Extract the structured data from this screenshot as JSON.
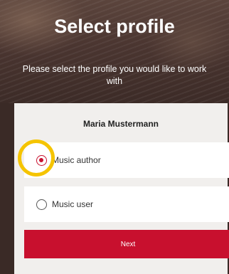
{
  "header": {
    "title": "Select profile",
    "subtitle": "Please select the profile you would like to work with"
  },
  "profile": {
    "user_name": "Maria Mustermann",
    "options": [
      {
        "label": "Music author",
        "selected": true
      },
      {
        "label": "Music user",
        "selected": false
      }
    ],
    "next_label": "Next"
  },
  "colors": {
    "accent": "#c8102e",
    "highlight": "#f5c400",
    "card_background": "#f1efed"
  }
}
